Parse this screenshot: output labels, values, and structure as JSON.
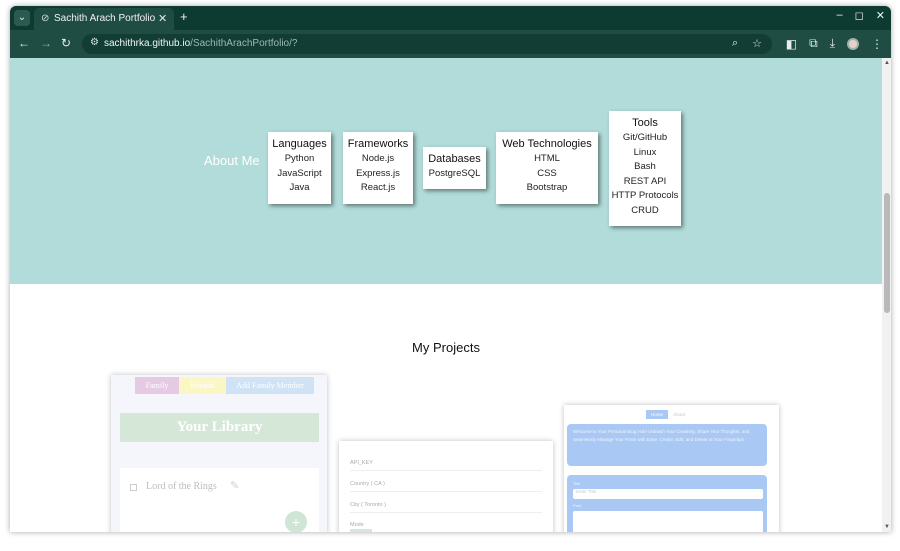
{
  "browser": {
    "tab_title": "Sachith Arach Portfolio",
    "new_tab_symbol": "+",
    "close_symbol": "✕",
    "url_host": "sachithrka.github.io",
    "url_path": "/SachithArachPortfolio/?",
    "window_controls": {
      "minimize": "–",
      "maximize": "◻",
      "close": "✕"
    }
  },
  "about": {
    "title": "About Me",
    "background_color": "#b1dcd9",
    "cards": [
      {
        "title": "Languages",
        "items": [
          "Python",
          "JavaScript",
          "Java"
        ]
      },
      {
        "title": "Frameworks",
        "items": [
          "Node.js",
          "Express.js",
          "React.js"
        ]
      },
      {
        "title": "Databases",
        "items": [
          "PostgreSQL"
        ]
      },
      {
        "title": "Web Technologies",
        "items": [
          "HTML",
          "CSS",
          "Bootstrap"
        ]
      },
      {
        "title": "Tools",
        "items": [
          "Git/GitHub",
          "Linux",
          "Bash",
          "REST API",
          "HTTP Protocols",
          "CRUD"
        ]
      }
    ]
  },
  "projects": {
    "title": "My Projects",
    "library_app": {
      "tabs": [
        "Family",
        "Friends",
        "Add Family Member"
      ],
      "heading": "Your Library",
      "item": "Lord of the Rings",
      "fab": "+"
    },
    "weather_app": {
      "fields": [
        "API_KEY",
        "Country ( CA )",
        "City ( Toronto )",
        "Mode"
      ]
    },
    "blog_app": {
      "tabs": [
        "Home",
        "About"
      ],
      "welcome": "Welcome to Your Personal Blog Hub! Unleash Your Creativity, Share Your Thoughts, and Seamlessly Manage Your Posts with Ease. Create, Edit, and Delete at Your Fingertips.",
      "form_labels": [
        "Title",
        "Post"
      ],
      "title_placeholder": "Enter Title"
    }
  }
}
